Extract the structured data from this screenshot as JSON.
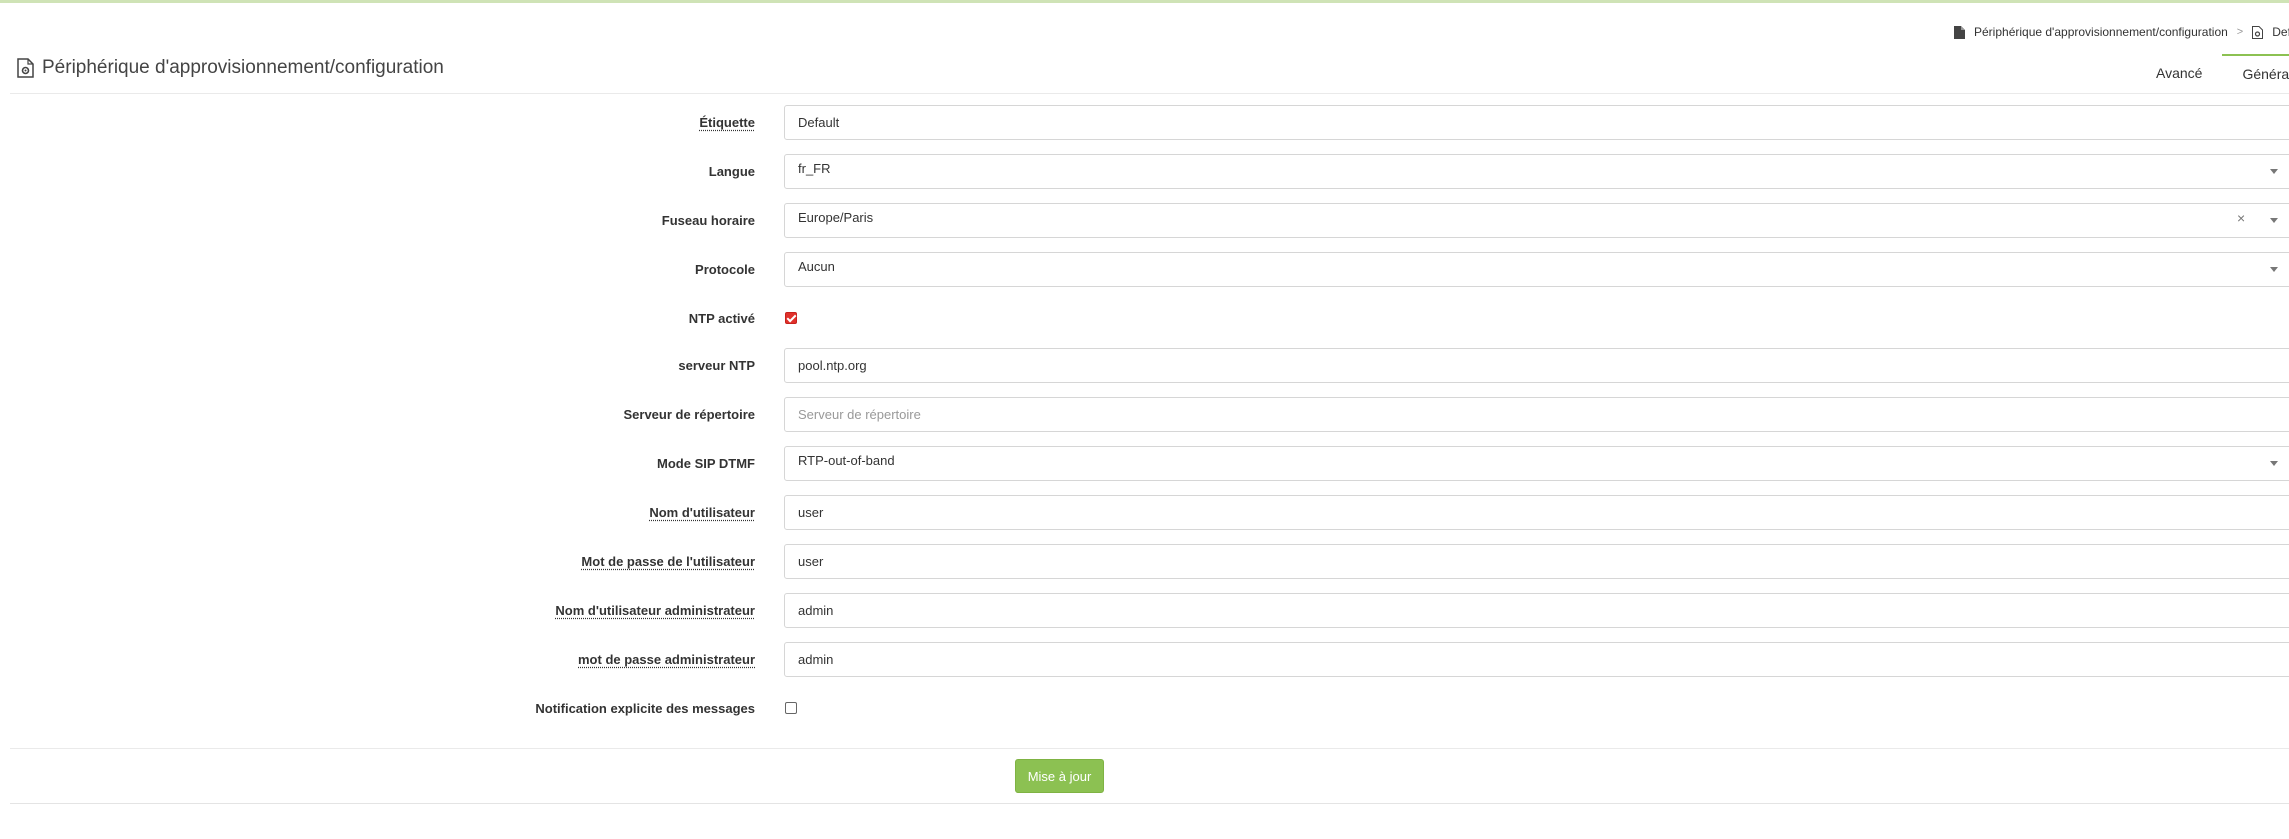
{
  "breadcrumb": {
    "items": [
      "Périphérique d'approvisionnement/configuration",
      "Defa"
    ],
    "separator": ">"
  },
  "header": {
    "title": "Périphérique d'approvisionnement/configuration"
  },
  "tabs": [
    {
      "label": "Avancé",
      "active": false
    },
    {
      "label": "Général",
      "active": true
    }
  ],
  "form": {
    "label_field": {
      "label": "Étiquette",
      "value": "Default"
    },
    "language": {
      "label": "Langue",
      "value": "fr_FR"
    },
    "timezone": {
      "label": "Fuseau horaire",
      "value": "Europe/Paris",
      "clear": "×"
    },
    "protocol": {
      "label": "Protocole",
      "value": "Aucun"
    },
    "ntp_enabled": {
      "label": "NTP activé",
      "checked": true
    },
    "ntp_server": {
      "label": "serveur NTP",
      "value": "pool.ntp.org"
    },
    "directory_server": {
      "label": "Serveur de répertoire",
      "value": "",
      "placeholder": "Serveur de répertoire"
    },
    "sip_dtmf_mode": {
      "label": "Mode SIP DTMF",
      "value": "RTP-out-of-band"
    },
    "username": {
      "label": "Nom d'utilisateur",
      "value": "user"
    },
    "user_password": {
      "label": "Mot de passe de l'utilisateur",
      "value": "user"
    },
    "admin_username": {
      "label": "Nom d'utilisateur administrateur",
      "value": "admin"
    },
    "admin_password": {
      "label": "mot de passe administrateur",
      "value": "admin"
    },
    "explicit_notification": {
      "label": "Notification explicite des messages",
      "checked": false
    }
  },
  "actions": {
    "submit_label": "Mise à jour"
  },
  "colors": {
    "accent": "#8cc152",
    "checkbox_checked": "#e0312b"
  }
}
